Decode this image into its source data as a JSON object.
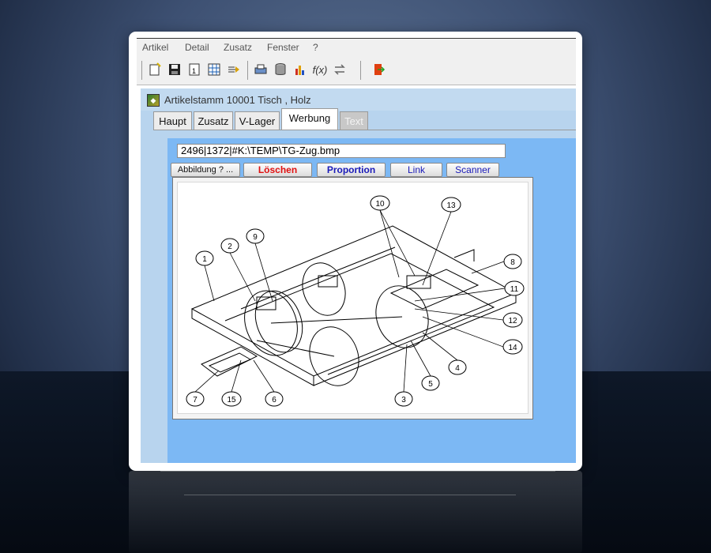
{
  "menu": [
    "Artikel",
    "Detail",
    "Zusatz",
    "Fenster",
    "?"
  ],
  "toolbar_icons": [
    "new-icon",
    "save-icon",
    "page-icon",
    "grid-icon",
    "arrow-icon",
    "print-icon",
    "database-icon",
    "chart-icon",
    "function-icon",
    "swap-icon",
    "exit-door-icon"
  ],
  "window": {
    "title": "Artikelstamm 10001 Tisch , Holz"
  },
  "tabs": [
    {
      "label": "Haupt"
    },
    {
      "label": "Zusatz"
    },
    {
      "label": "V-Lager"
    },
    {
      "label": "Werbung",
      "active": true
    },
    {
      "label": "Text",
      "disabled": true
    }
  ],
  "werbung": {
    "path_value": "2496|1372|#K:\\TEMP\\TG-Zug.bmp",
    "buttons": {
      "abbildung": "Abbildung  ? ...",
      "loeschen": "Löschen",
      "proportion": "Proportion",
      "link": "Link",
      "scanner": "Scanner"
    },
    "colors": {
      "loeschen": "#e01010",
      "proportion": "#1a1ab8",
      "link": "#1a1ab8",
      "scanner": "#1a1ab8"
    }
  },
  "drawing_callouts": [
    "1",
    "2",
    "3",
    "4",
    "5",
    "6",
    "7",
    "8",
    "9",
    "10",
    "11",
    "12",
    "13",
    "14",
    "15"
  ]
}
